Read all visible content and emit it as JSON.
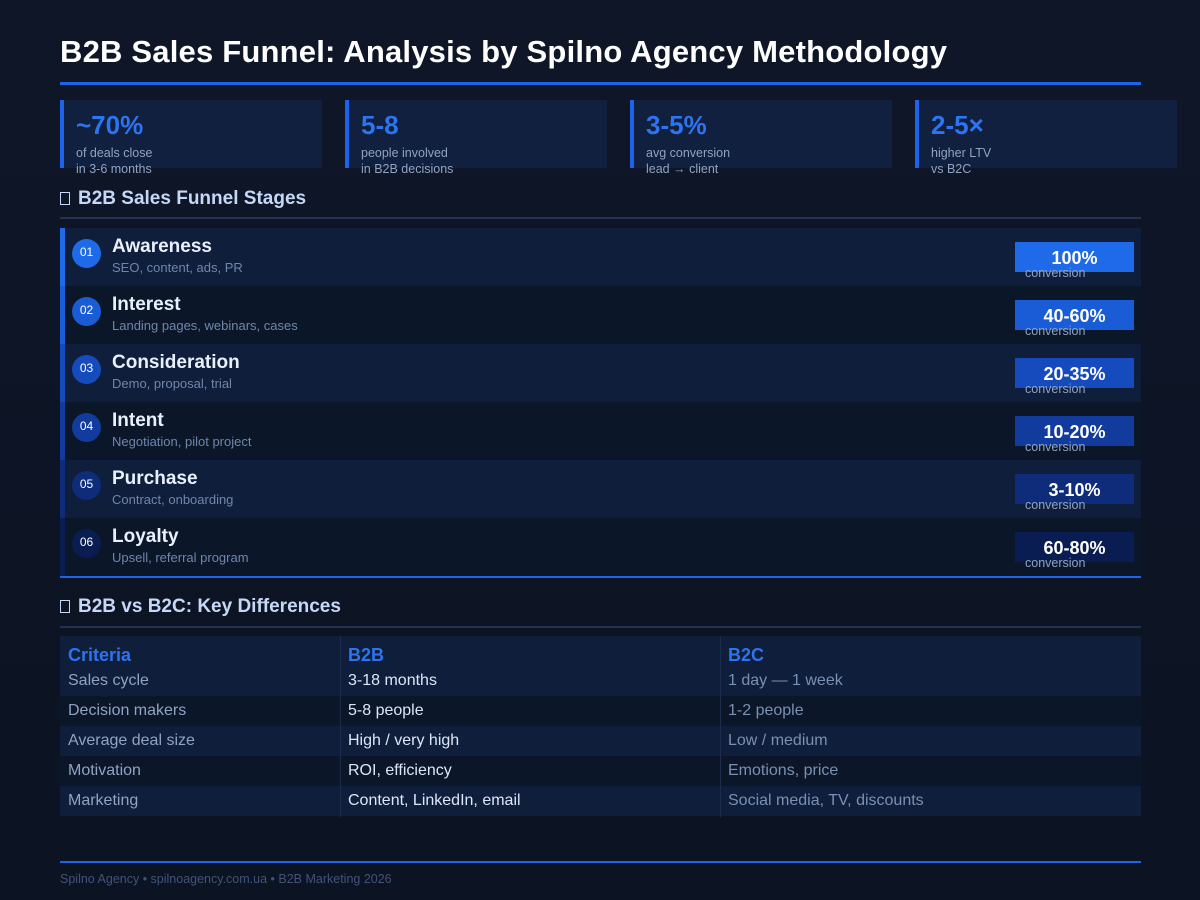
{
  "page": {
    "title": "B2B Sales Funnel: Analysis by Spilno Agency Methodology"
  },
  "stats": [
    {
      "value": "~70%",
      "line1": "of deals close",
      "line2": "in 3-6 months"
    },
    {
      "value": "5-8",
      "line1": "people involved",
      "line2": "in B2B decisions"
    },
    {
      "value": "3-5%",
      "line1": "avg conversion",
      "line2": "lead → client"
    },
    {
      "value": "2-5×",
      "line1": "higher LTV",
      "line2": "vs B2C"
    }
  ],
  "funnel": {
    "heading": "B2B Sales Funnel Stages",
    "heading_icon": "chart-icon",
    "conversion_label": "conversion",
    "stages": [
      {
        "num": "01",
        "name": "Awareness",
        "sub": "SEO, content, ads, PR",
        "rate": "100%",
        "color": "#1e6ae8"
      },
      {
        "num": "02",
        "name": "Interest",
        "sub": "Landing pages, webinars, cases",
        "rate": "40-60%",
        "color": "#1a5bd6"
      },
      {
        "num": "03",
        "name": "Consideration",
        "sub": "Demo, proposal, trial",
        "rate": "20-35%",
        "color": "#164bbd"
      },
      {
        "num": "04",
        "name": "Intent",
        "sub": "Negotiation, pilot project",
        "rate": "10-20%",
        "color": "#123b9e"
      },
      {
        "num": "05",
        "name": "Purchase",
        "sub": "Contract, onboarding",
        "rate": "3-10%",
        "color": "#0e2c7a"
      },
      {
        "num": "06",
        "name": "Loyalty",
        "sub": "Upsell, referral program",
        "rate": "60-80%",
        "color": "#0a1d52"
      }
    ]
  },
  "comparison": {
    "heading": "B2B vs B2C: Key Differences",
    "heading_icon": "compare-icon",
    "headers": [
      "Criteria",
      "B2B",
      "B2C"
    ],
    "rows": [
      [
        "Sales cycle",
        "3-18 months",
        "1 day — 1 week"
      ],
      [
        "Decision makers",
        "5-8 people",
        "1-2 people"
      ],
      [
        "Average deal size",
        "High / very high",
        "Low / medium"
      ],
      [
        "Motivation",
        "ROI, efficiency",
        "Emotions, price"
      ],
      [
        "Marketing",
        "Content, LinkedIn, email",
        "Social media, TV, discounts"
      ]
    ]
  },
  "footer": {
    "text": "Spilno Agency • spilnoagency.com.ua • B2B Marketing 2026"
  },
  "colors": {
    "accent": "#1e63e9",
    "background": "#0e1628"
  }
}
